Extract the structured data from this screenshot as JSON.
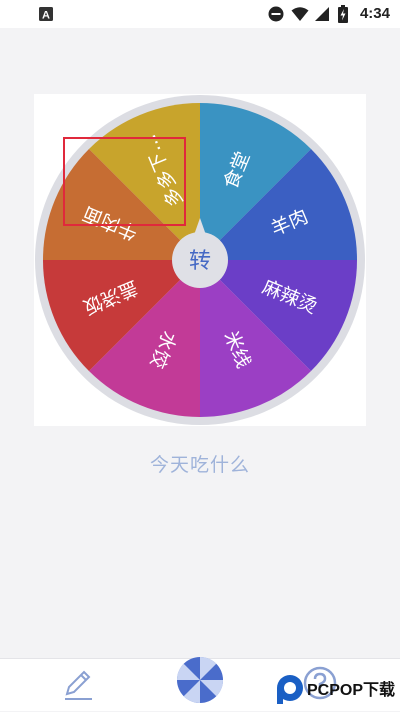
{
  "status_bar": {
    "time": "4:34",
    "icons": [
      "app-notification-icon",
      "do-not-disturb-icon",
      "wifi-icon",
      "signal-icon",
      "battery-charging-icon"
    ]
  },
  "wheel": {
    "center_label": "转",
    "selected_index": 0,
    "highlight_color": "#e0293c",
    "segments": [
      {
        "label": "多多下…",
        "color": "#c8a42c"
      },
      {
        "label": "食堂",
        "color": "#3a93c2"
      },
      {
        "label": "羊肉",
        "color": "#3b5fc2"
      },
      {
        "label": "麻辣烫",
        "color": "#6b3ec7"
      },
      {
        "label": "米线",
        "color": "#9b3fc4"
      },
      {
        "label": "水饺",
        "color": "#c23a97"
      },
      {
        "label": "盖浇饭",
        "color": "#c63a3a"
      },
      {
        "label": "牛肉面",
        "color": "#c66d33"
      }
    ]
  },
  "question": "今天吃什么",
  "bottom_bar": {
    "items": [
      {
        "icon": "edit-pencil-icon"
      },
      {
        "icon": "spin-wheel-icon"
      },
      {
        "icon": "help-question-icon"
      }
    ]
  },
  "watermark": {
    "text": "PCPOP下载"
  }
}
